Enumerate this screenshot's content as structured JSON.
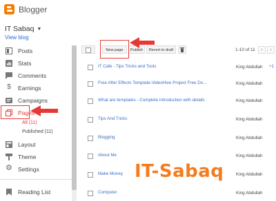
{
  "app": {
    "name": "Blogger"
  },
  "blog": {
    "name": "IT Sabaq",
    "view_blog": "View blog"
  },
  "sidebar": {
    "items": [
      {
        "label": "Posts",
        "icon": "posts-icon"
      },
      {
        "label": "Stats",
        "icon": "stats-icon"
      },
      {
        "label": "Comments",
        "icon": "comments-icon"
      },
      {
        "label": "Earnings",
        "icon": "dollar-icon"
      },
      {
        "label": "Campaigns",
        "icon": "campaigns-icon"
      },
      {
        "label": "Pages",
        "icon": "pages-icon",
        "active": true
      },
      {
        "label": "Layout",
        "icon": "layout-icon"
      },
      {
        "label": "Theme",
        "icon": "theme-icon"
      },
      {
        "label": "Settings",
        "icon": "gear-icon"
      },
      {
        "label": "Reading List",
        "icon": "bookmark-icon"
      }
    ],
    "pages_sub": {
      "all": "All (11)",
      "published": "Published (11)"
    }
  },
  "toolbar": {
    "new_page": "New page",
    "publish": "Publish",
    "revert": "Revert to draft",
    "pagination": "1-10 of 11"
  },
  "pages": [
    {
      "title": "IT Cafe - Tips Tricks and Tools",
      "author": "King Abdullah",
      "extra": "+1"
    },
    {
      "title": "Free After Effects Template-VideoHive Project Free Do...",
      "author": "King Abdullah"
    },
    {
      "title": "What are templates - Complete Introduction with details",
      "author": "King Abdullah"
    },
    {
      "title": "Tips And Tricks",
      "author": "King Abdullah"
    },
    {
      "title": "Blogging",
      "author": "King Abdullah"
    },
    {
      "title": "About Me",
      "author": "King Abdullah"
    },
    {
      "title": "Make Money",
      "author": "King Abdullah"
    },
    {
      "title": "Computer",
      "author": "King Abdullah"
    }
  ],
  "watermark": "IT-Sabaq",
  "colors": {
    "brand": "#f57d00",
    "link": "#3c6ec6",
    "active": "#e53935",
    "highlight": "#e53935"
  }
}
